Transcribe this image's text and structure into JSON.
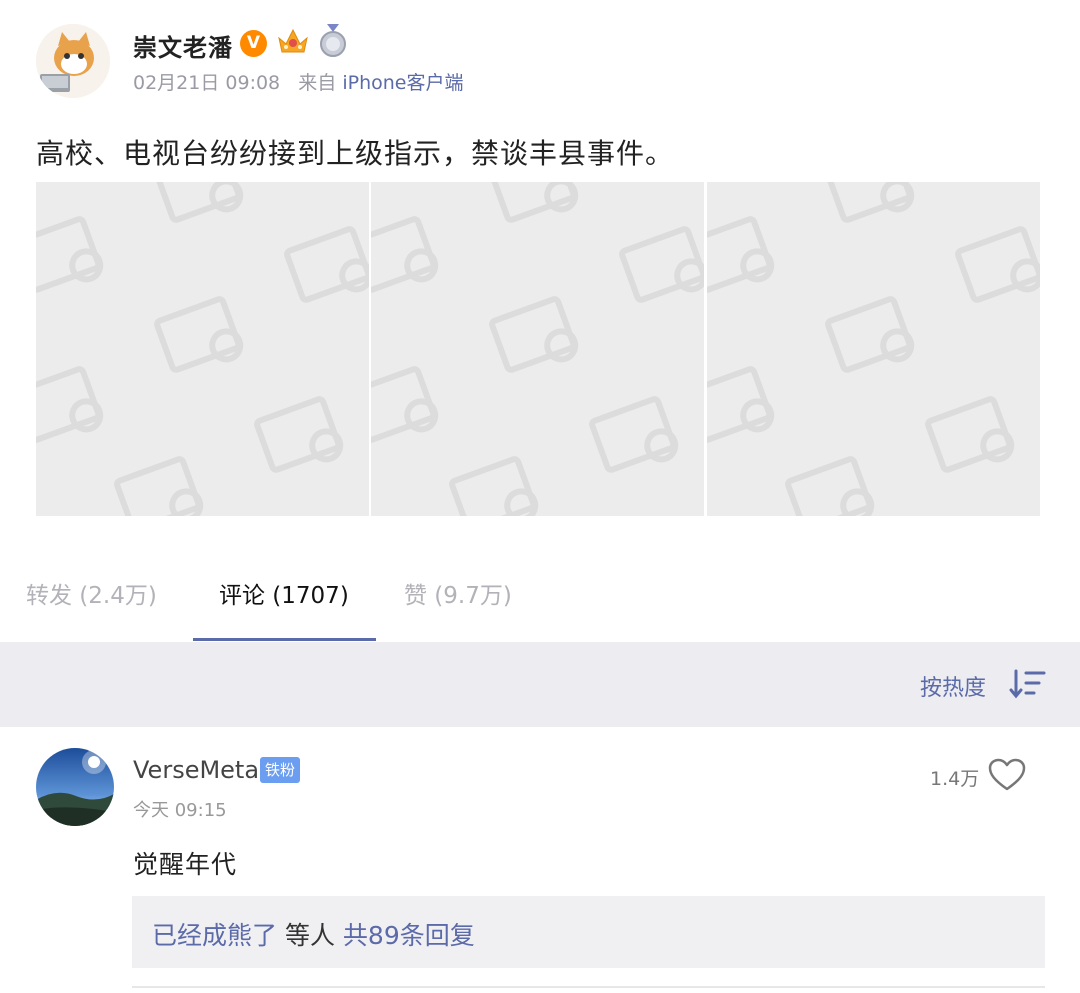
{
  "post": {
    "username": "崇文老潘",
    "verified_badge": "V",
    "date": "02月21日 09:08",
    "source_prefix": "来自",
    "source_device": "iPhone客户端",
    "text": "高校、电视台纷纷接到上级指示，禁谈丰县事件。",
    "images": [
      {
        "icon": "image-placeholder-icon"
      },
      {
        "icon": "image-placeholder-icon"
      },
      {
        "icon": "image-placeholder-icon"
      }
    ]
  },
  "tabs": [
    {
      "label": "转发 (2.4万)",
      "active": false
    },
    {
      "label": "评论 (1707)",
      "active": true
    },
    {
      "label": "赞 (9.7万)",
      "active": false
    }
  ],
  "sort": {
    "label": "按热度",
    "icon": "sort-icon"
  },
  "comment": {
    "username": "VerseMeta",
    "fan_badge": "铁粉",
    "time": "今天 09:15",
    "likes": "1.4万",
    "text": "觉醒年代",
    "reply_user": "已经成熊了",
    "reply_mid": " 等人 ",
    "reply_count": "共89条回复"
  },
  "colors": {
    "accent": "#5b6aa8",
    "verified": "#ff8a00",
    "fan_badge": "#6b9df0",
    "sortbar_bg": "#ededf1"
  }
}
